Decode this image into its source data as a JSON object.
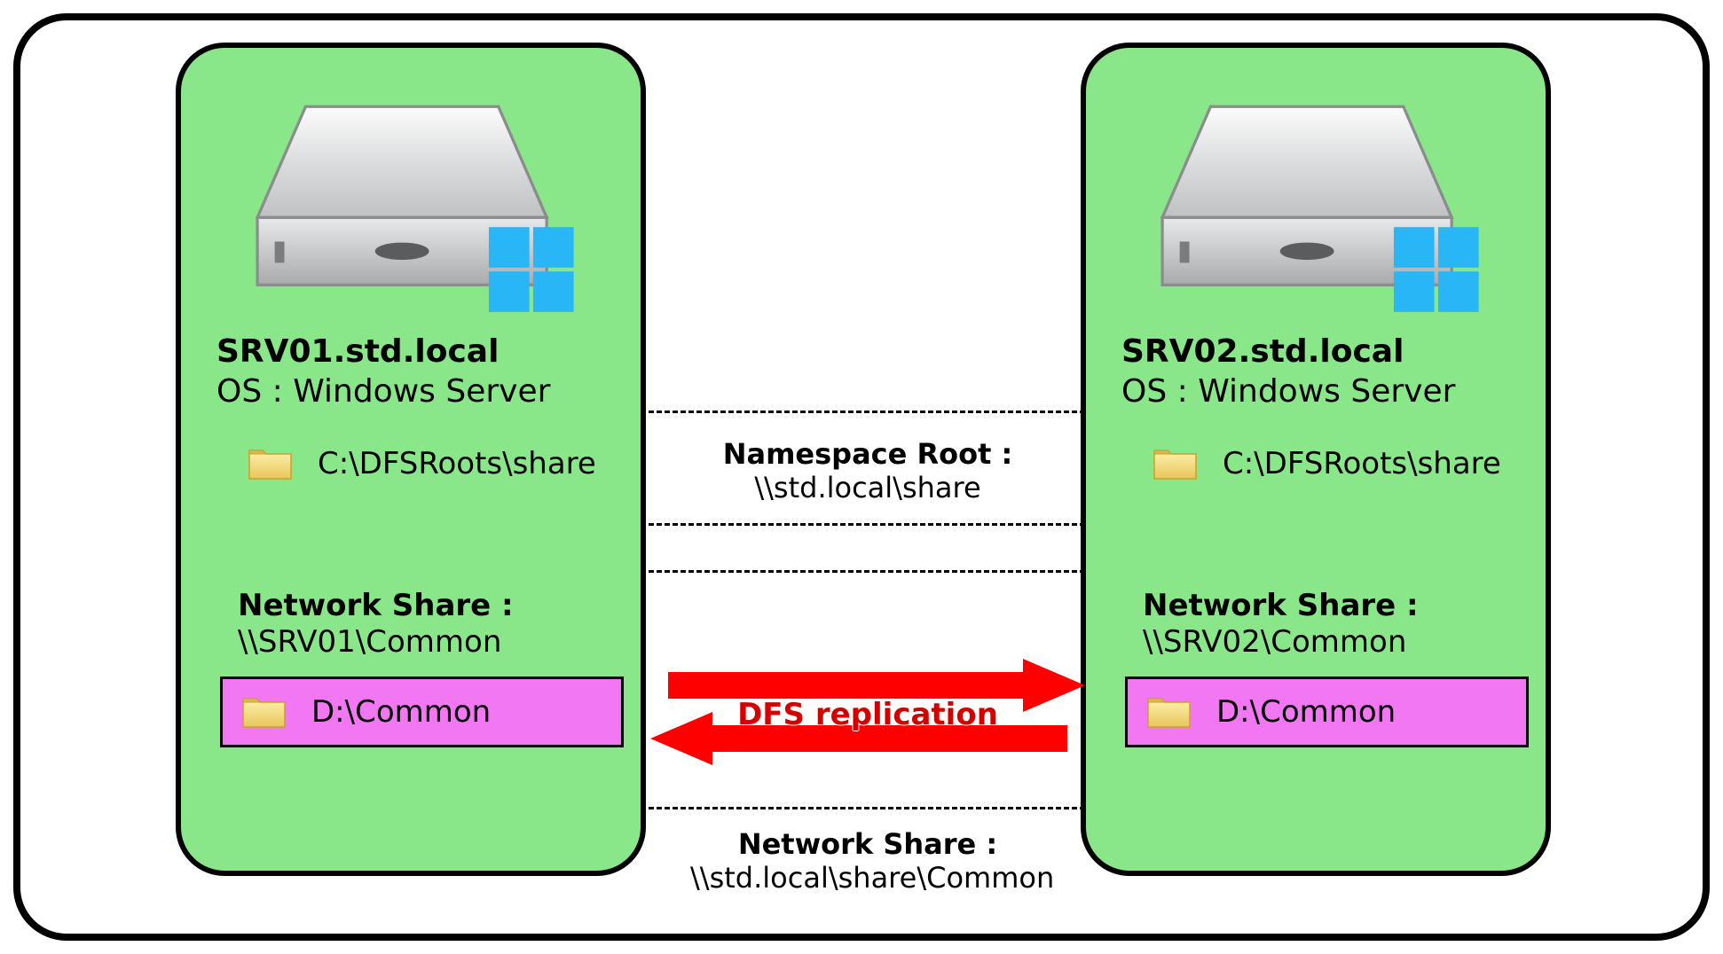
{
  "servers": {
    "left": {
      "host": "SRV01.std.local",
      "os": "OS : Windows Server",
      "dfs_root_path": "C:\\DFSRoots\\share",
      "network_share_title": "Network Share :",
      "network_share_path": "\\\\SRV01\\Common",
      "local_path": "D:\\Common"
    },
    "right": {
      "host": "SRV02.std.local",
      "os": "OS : Windows Server",
      "dfs_root_path": "C:\\DFSRoots\\share",
      "network_share_title": "Network Share :",
      "network_share_path": "\\\\SRV02\\Common",
      "local_path": "D:\\Common"
    }
  },
  "namespace": {
    "title": "Namespace Root :",
    "path": "\\\\std.local\\share"
  },
  "replication_label": "DFS replication",
  "bottom_share": {
    "title": "Network Share :",
    "path": "\\\\std.local\\share\\Common"
  },
  "colors": {
    "server_box": "#89e789",
    "replicated_folder": "#f277f2",
    "arrow": "#ff0000",
    "windows_logo": "#29b6f6"
  }
}
